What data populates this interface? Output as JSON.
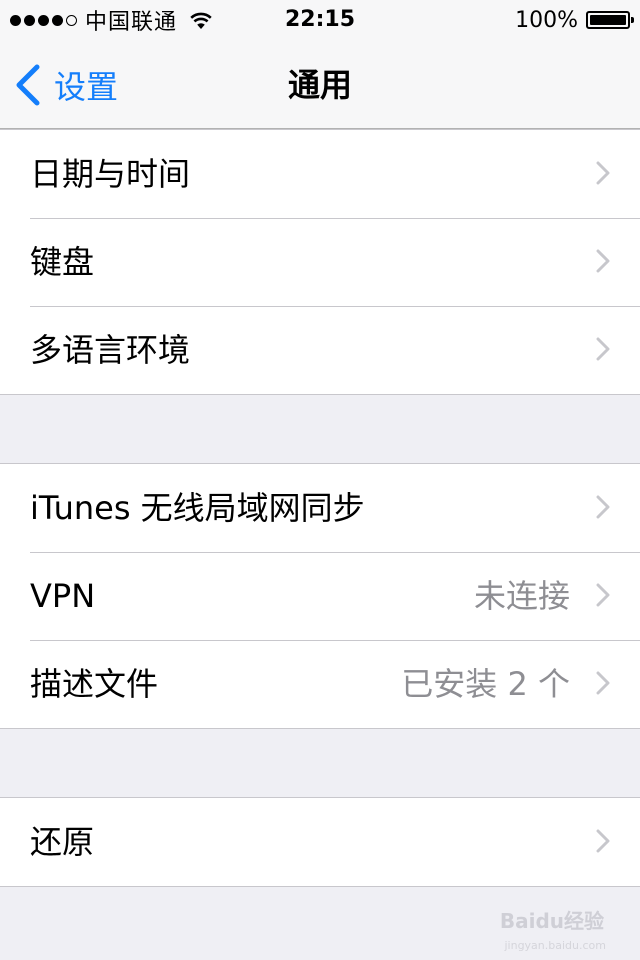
{
  "status_bar": {
    "carrier": "中国联通",
    "time": "22:15",
    "battery": "100%",
    "signal_bars_filled": 4,
    "signal_bars_total": 5
  },
  "nav": {
    "back_label": "设置",
    "title": "通用"
  },
  "groups": [
    {
      "rows": [
        {
          "label": "日期与时间",
          "detail": ""
        },
        {
          "label": "键盘",
          "detail": ""
        },
        {
          "label": "多语言环境",
          "detail": ""
        }
      ]
    },
    {
      "rows": [
        {
          "label": "iTunes 无线局域网同步",
          "detail": ""
        },
        {
          "label": "VPN",
          "detail": "未连接"
        },
        {
          "label": "描述文件",
          "detail": "已安装 2 个"
        }
      ]
    },
    {
      "rows": [
        {
          "label": "还原",
          "detail": ""
        }
      ]
    }
  ],
  "watermark": {
    "text": "Baidu经验",
    "sub": "jingyan.baidu.com"
  },
  "colors": {
    "accent": "#147efb",
    "background": "#efeff4",
    "separator": "#c8c7cc",
    "detail_text": "#8e8e93",
    "chevron": "#c7c7cc"
  },
  "icons": {
    "back": "chevron-left-icon",
    "disclosure": "chevron-right-icon",
    "wifi": "wifi-icon",
    "battery": "battery-icon"
  }
}
